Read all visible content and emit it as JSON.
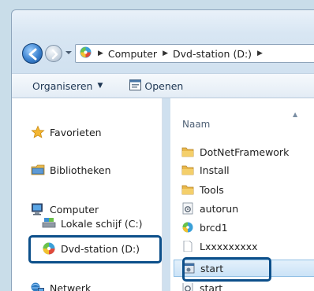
{
  "nav": {
    "breadcrumb": [
      "Computer",
      "Dvd-station (D:)"
    ]
  },
  "toolbar": {
    "organize_label": "Organiseren",
    "open_label": "Openen"
  },
  "navpane": {
    "favorites": "Favorieten",
    "libraries": "Bibliotheken",
    "computer": "Computer",
    "local_disk": "Lokale schijf (C:)",
    "dvd_drive": "Dvd-station (D:)",
    "network": "Netwerk"
  },
  "filepane": {
    "column_name": "Naam",
    "files": [
      {
        "name": "DotNetFramework",
        "icon": "folder-icon"
      },
      {
        "name": "Install",
        "icon": "folder-icon"
      },
      {
        "name": "Tools",
        "icon": "folder-icon"
      },
      {
        "name": "autorun",
        "icon": "settings-file-icon"
      },
      {
        "name": "brcd1",
        "icon": "setup-icon"
      },
      {
        "name": "Lxxxxxxxxx",
        "icon": "document-icon"
      },
      {
        "name": "start",
        "icon": "application-icon"
      },
      {
        "name": "start",
        "icon": "settings-file-icon"
      }
    ]
  },
  "colors": {
    "highlight": "#0c4f8a",
    "selection": "#cbe3f7"
  }
}
